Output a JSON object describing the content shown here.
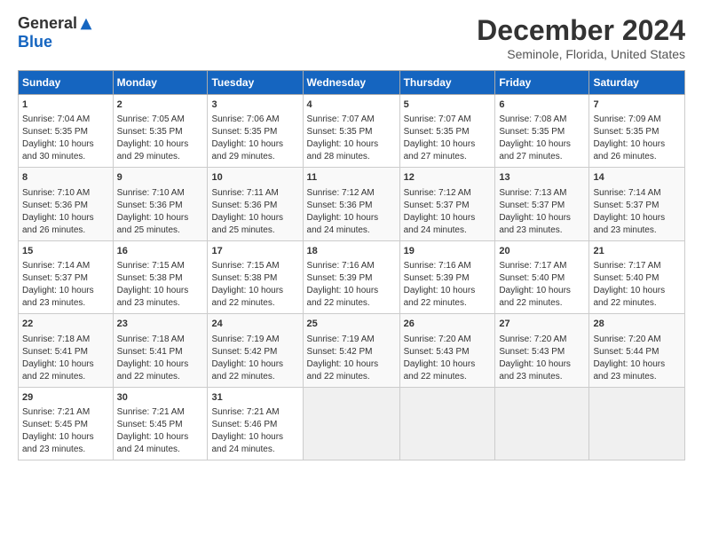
{
  "header": {
    "logo_general": "General",
    "logo_blue": "Blue",
    "month_title": "December 2024",
    "location": "Seminole, Florida, United States"
  },
  "days_of_week": [
    "Sunday",
    "Monday",
    "Tuesday",
    "Wednesday",
    "Thursday",
    "Friday",
    "Saturday"
  ],
  "weeks": [
    [
      {
        "day": "1",
        "content": "Sunrise: 7:04 AM\nSunset: 5:35 PM\nDaylight: 10 hours and 30 minutes."
      },
      {
        "day": "2",
        "content": "Sunrise: 7:05 AM\nSunset: 5:35 PM\nDaylight: 10 hours and 29 minutes."
      },
      {
        "day": "3",
        "content": "Sunrise: 7:06 AM\nSunset: 5:35 PM\nDaylight: 10 hours and 29 minutes."
      },
      {
        "day": "4",
        "content": "Sunrise: 7:07 AM\nSunset: 5:35 PM\nDaylight: 10 hours and 28 minutes."
      },
      {
        "day": "5",
        "content": "Sunrise: 7:07 AM\nSunset: 5:35 PM\nDaylight: 10 hours and 27 minutes."
      },
      {
        "day": "6",
        "content": "Sunrise: 7:08 AM\nSunset: 5:35 PM\nDaylight: 10 hours and 27 minutes."
      },
      {
        "day": "7",
        "content": "Sunrise: 7:09 AM\nSunset: 5:35 PM\nDaylight: 10 hours and 26 minutes."
      }
    ],
    [
      {
        "day": "8",
        "content": "Sunrise: 7:10 AM\nSunset: 5:36 PM\nDaylight: 10 hours and 26 minutes."
      },
      {
        "day": "9",
        "content": "Sunrise: 7:10 AM\nSunset: 5:36 PM\nDaylight: 10 hours and 25 minutes."
      },
      {
        "day": "10",
        "content": "Sunrise: 7:11 AM\nSunset: 5:36 PM\nDaylight: 10 hours and 25 minutes."
      },
      {
        "day": "11",
        "content": "Sunrise: 7:12 AM\nSunset: 5:36 PM\nDaylight: 10 hours and 24 minutes."
      },
      {
        "day": "12",
        "content": "Sunrise: 7:12 AM\nSunset: 5:37 PM\nDaylight: 10 hours and 24 minutes."
      },
      {
        "day": "13",
        "content": "Sunrise: 7:13 AM\nSunset: 5:37 PM\nDaylight: 10 hours and 23 minutes."
      },
      {
        "day": "14",
        "content": "Sunrise: 7:14 AM\nSunset: 5:37 PM\nDaylight: 10 hours and 23 minutes."
      }
    ],
    [
      {
        "day": "15",
        "content": "Sunrise: 7:14 AM\nSunset: 5:37 PM\nDaylight: 10 hours and 23 minutes."
      },
      {
        "day": "16",
        "content": "Sunrise: 7:15 AM\nSunset: 5:38 PM\nDaylight: 10 hours and 23 minutes."
      },
      {
        "day": "17",
        "content": "Sunrise: 7:15 AM\nSunset: 5:38 PM\nDaylight: 10 hours and 22 minutes."
      },
      {
        "day": "18",
        "content": "Sunrise: 7:16 AM\nSunset: 5:39 PM\nDaylight: 10 hours and 22 minutes."
      },
      {
        "day": "19",
        "content": "Sunrise: 7:16 AM\nSunset: 5:39 PM\nDaylight: 10 hours and 22 minutes."
      },
      {
        "day": "20",
        "content": "Sunrise: 7:17 AM\nSunset: 5:40 PM\nDaylight: 10 hours and 22 minutes."
      },
      {
        "day": "21",
        "content": "Sunrise: 7:17 AM\nSunset: 5:40 PM\nDaylight: 10 hours and 22 minutes."
      }
    ],
    [
      {
        "day": "22",
        "content": "Sunrise: 7:18 AM\nSunset: 5:41 PM\nDaylight: 10 hours and 22 minutes."
      },
      {
        "day": "23",
        "content": "Sunrise: 7:18 AM\nSunset: 5:41 PM\nDaylight: 10 hours and 22 minutes."
      },
      {
        "day": "24",
        "content": "Sunrise: 7:19 AM\nSunset: 5:42 PM\nDaylight: 10 hours and 22 minutes."
      },
      {
        "day": "25",
        "content": "Sunrise: 7:19 AM\nSunset: 5:42 PM\nDaylight: 10 hours and 22 minutes."
      },
      {
        "day": "26",
        "content": "Sunrise: 7:20 AM\nSunset: 5:43 PM\nDaylight: 10 hours and 22 minutes."
      },
      {
        "day": "27",
        "content": "Sunrise: 7:20 AM\nSunset: 5:43 PM\nDaylight: 10 hours and 23 minutes."
      },
      {
        "day": "28",
        "content": "Sunrise: 7:20 AM\nSunset: 5:44 PM\nDaylight: 10 hours and 23 minutes."
      }
    ],
    [
      {
        "day": "29",
        "content": "Sunrise: 7:21 AM\nSunset: 5:45 PM\nDaylight: 10 hours and 23 minutes."
      },
      {
        "day": "30",
        "content": "Sunrise: 7:21 AM\nSunset: 5:45 PM\nDaylight: 10 hours and 24 minutes."
      },
      {
        "day": "31",
        "content": "Sunrise: 7:21 AM\nSunset: 5:46 PM\nDaylight: 10 hours and 24 minutes."
      },
      {
        "day": "",
        "content": ""
      },
      {
        "day": "",
        "content": ""
      },
      {
        "day": "",
        "content": ""
      },
      {
        "day": "",
        "content": ""
      }
    ]
  ]
}
